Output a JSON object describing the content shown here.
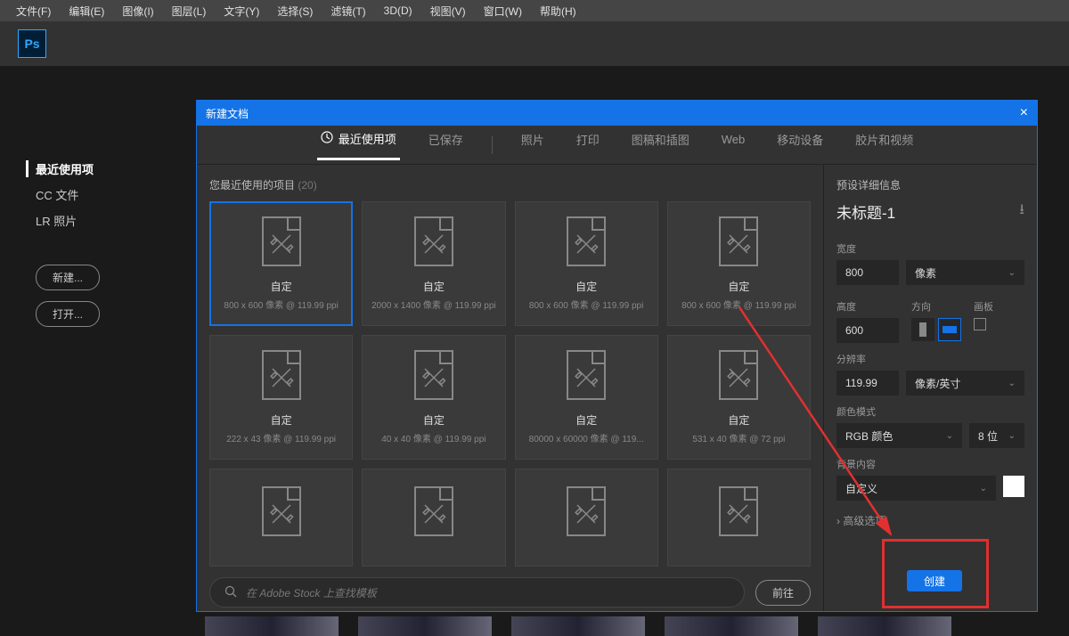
{
  "menubar": [
    "文件(F)",
    "编辑(E)",
    "图像(I)",
    "图层(L)",
    "文字(Y)",
    "选择(S)",
    "滤镜(T)",
    "3D(D)",
    "视图(V)",
    "窗口(W)",
    "帮助(H)"
  ],
  "logo": "Ps",
  "bg_sidebar": {
    "items": [
      "最近使用项",
      "CC 文件",
      "LR 照片"
    ],
    "new_btn": "新建...",
    "open_btn": "打开..."
  },
  "dialog": {
    "title": "新建文档",
    "tabs": [
      "最近使用项",
      "已保存",
      "照片",
      "打印",
      "图稿和插图",
      "Web",
      "移动设备",
      "胶片和视频"
    ],
    "recent_header": "您最近使用的项目",
    "recent_count": "(20)",
    "presets": [
      {
        "name": "自定",
        "meta": "800 x 600 像素 @ 119.99 ppi",
        "selected": true
      },
      {
        "name": "自定",
        "meta": "2000 x 1400 像素 @ 119.99 ppi"
      },
      {
        "name": "自定",
        "meta": "800 x 600 像素 @ 119.99 ppi"
      },
      {
        "name": "自定",
        "meta": "800 x 600 像素 @ 119.99 ppi"
      },
      {
        "name": "自定",
        "meta": "222 x 43 像素 @ 119.99 ppi"
      },
      {
        "name": "自定",
        "meta": "40 x 40 像素 @ 119.99 ppi"
      },
      {
        "name": "自定",
        "meta": "80000 x 60000 像素 @ 119..."
      },
      {
        "name": "自定",
        "meta": "531 x 40 像素 @ 72 ppi"
      }
    ],
    "search_placeholder": "在 Adobe Stock 上查找模板",
    "go_btn": "前往"
  },
  "panel": {
    "header": "预设详细信息",
    "doc_name": "未标题-1",
    "width_label": "宽度",
    "width": "800",
    "width_unit": "像素",
    "height_label": "高度",
    "height": "600",
    "orient_label": "方向",
    "artboard_label": "画板",
    "res_label": "分辨率",
    "res": "119.99",
    "res_unit": "像素/英寸",
    "color_label": "颜色模式",
    "color_mode": "RGB 颜色",
    "color_depth": "8 位",
    "bg_label": "背景内容",
    "bg_value": "自定义",
    "advanced": "高级选项"
  },
  "create_btn": "创建"
}
